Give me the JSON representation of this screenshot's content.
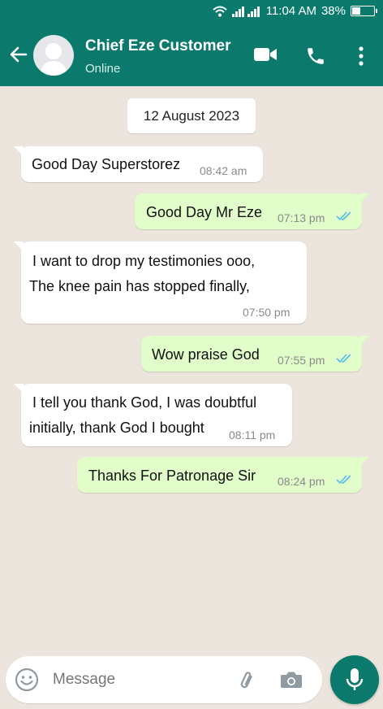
{
  "status_bar": {
    "time": "11:04 AM",
    "battery": "38%",
    "battery_level": 0.38
  },
  "header": {
    "name": "Chief Eze Customer",
    "status": "Online"
  },
  "chat": {
    "date": "12 August 2023",
    "messages": [
      {
        "dir": "in",
        "lines": [
          "Good Day Superstorez"
        ],
        "time": "08:42 am"
      },
      {
        "dir": "out",
        "lines": [
          "Good Day Mr Eze"
        ],
        "time": "07:13 pm",
        "read": true
      },
      {
        "dir": "in",
        "lines": [
          "I want to drop my testimonies ooo,",
          "The knee pain has stopped finally,"
        ],
        "time": "07:50 pm"
      },
      {
        "dir": "out",
        "lines": [
          "Wow praise God"
        ],
        "time": "07:55 pm",
        "read": true
      },
      {
        "dir": "in",
        "lines": [
          "I tell you thank God, I was doubtful",
          "initially, thank God I bought"
        ],
        "time": "08:11 pm"
      },
      {
        "dir": "out",
        "lines": [
          "Thanks For Patronage Sir"
        ],
        "time": "08:24 pm",
        "read": true
      }
    ]
  },
  "composer": {
    "placeholder": "Message"
  },
  "colors": {
    "primary": "#0b7a6c",
    "outgoing_bubble": "#e1fdc9",
    "read_ticks": "#53bdeb",
    "chat_bg": "#ece5dd"
  }
}
